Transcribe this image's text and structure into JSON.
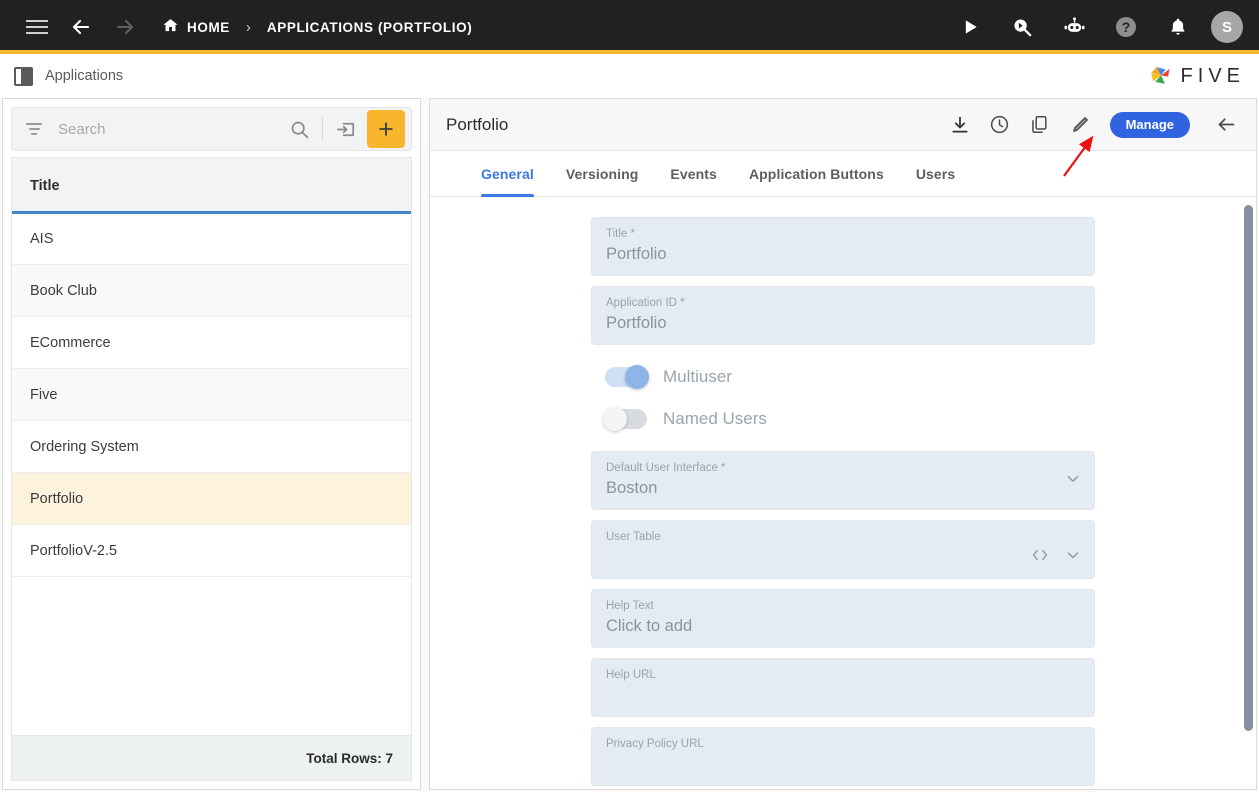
{
  "topbar": {
    "menu_icon": "hamburger-icon",
    "back_icon": "arrow-left-icon",
    "forward_icon": "arrow-right-icon",
    "home_label": "HOME",
    "separator": "›",
    "breadcrumb_current": "APPLICATIONS (PORTFOLIO)",
    "icons": [
      "play-icon",
      "search-play-icon",
      "robot-icon",
      "help-icon",
      "bell-icon"
    ],
    "avatar_initial": "S",
    "accent_bar_color": "#f5b72b",
    "background_color": "#212121"
  },
  "subbar": {
    "panel_icon": "split-panel-icon",
    "title": "Applications",
    "brand_text": "FIVE"
  },
  "sidebar": {
    "search": {
      "placeholder": "Search",
      "value": ""
    },
    "filter_icon": "filter-icon",
    "search_icon": "search-icon",
    "import_icon": "import-icon",
    "add_icon": "plus-icon",
    "add_button_color": "#f8b62c",
    "column_header": "Title",
    "rows": [
      {
        "title": "AIS",
        "selected": false
      },
      {
        "title": "Book Club",
        "selected": false
      },
      {
        "title": "ECommerce",
        "selected": false
      },
      {
        "title": "Five",
        "selected": false
      },
      {
        "title": "Ordering System",
        "selected": false
      },
      {
        "title": "Portfolio",
        "selected": true
      },
      {
        "title": "PortfolioV-2.5",
        "selected": false
      }
    ],
    "total_rows": "Total Rows: 7",
    "selected_row_color": "#fdf3dd",
    "header_underline_color": "#4285c9"
  },
  "detail": {
    "title": "Portfolio",
    "header_icons": [
      {
        "name": "download-icon"
      },
      {
        "name": "history-icon"
      },
      {
        "name": "copy-icon"
      },
      {
        "name": "edit-pencil-icon"
      }
    ],
    "manage_label": "Manage",
    "manage_color": "#2f63e0",
    "back_icon": "arrow-left-icon",
    "tabs": [
      {
        "label": "General",
        "active": true
      },
      {
        "label": "Versioning",
        "active": false
      },
      {
        "label": "Events",
        "active": false
      },
      {
        "label": "Application Buttons",
        "active": false
      },
      {
        "label": "Users",
        "active": false
      }
    ],
    "active_tab_color": "#3b78e7",
    "fields": [
      {
        "label": "Title *",
        "value": "Portfolio",
        "type": "text"
      },
      {
        "label": "Application ID *",
        "value": "Portfolio",
        "type": "text"
      },
      {
        "label": "Multiuser",
        "value": "on",
        "type": "toggle"
      },
      {
        "label": "Named Users",
        "value": "off",
        "type": "toggle"
      },
      {
        "label": "Default User Interface *",
        "value": "Boston",
        "type": "select"
      },
      {
        "label": "User Table",
        "value": "",
        "type": "select-code"
      },
      {
        "label": "Help Text",
        "value": "Click to add",
        "type": "text"
      },
      {
        "label": "Help URL",
        "value": "",
        "type": "text"
      },
      {
        "label": "Privacy Policy URL",
        "value": "",
        "type": "text"
      }
    ]
  },
  "annotation": {
    "arrow_color": "#ee1111",
    "points_to": "edit-pencil-icon"
  }
}
